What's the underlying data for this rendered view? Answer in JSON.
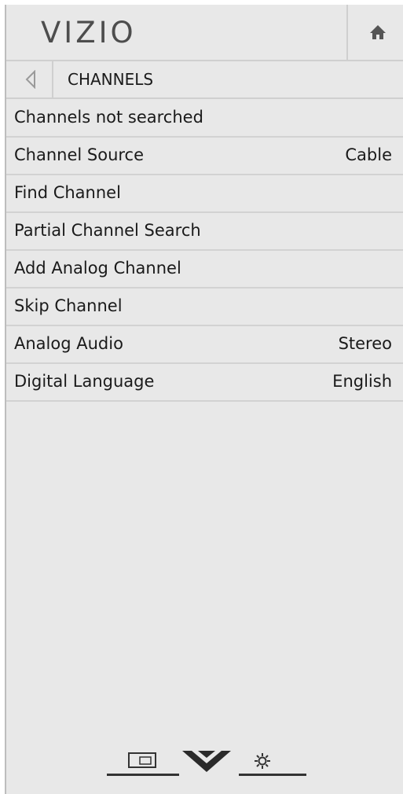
{
  "header": {
    "logo_text": "VIZIO",
    "home_icon": "home-icon"
  },
  "nav": {
    "back_icon": "back-arrow-icon",
    "title": "CHANNELS"
  },
  "menu": [
    {
      "label": "Channels not searched",
      "value": ""
    },
    {
      "label": "Channel Source",
      "value": "Cable"
    },
    {
      "label": "Find Channel",
      "value": ""
    },
    {
      "label": "Partial Channel Search",
      "value": ""
    },
    {
      "label": "Add Analog Channel",
      "value": ""
    },
    {
      "label": "Skip Channel",
      "value": ""
    },
    {
      "label": "Analog Audio",
      "value": "Stereo"
    },
    {
      "label": "Digital Language",
      "value": "English"
    }
  ],
  "bottom_bar": {
    "icons": [
      "inputs-icon",
      "vizio-v-icon",
      "settings-icon"
    ]
  },
  "colors": {
    "panel_bg": "#e8e8e8",
    "divider": "#d2d2d2",
    "text": "#1a1a1a",
    "logo": "#4d4d4d"
  }
}
